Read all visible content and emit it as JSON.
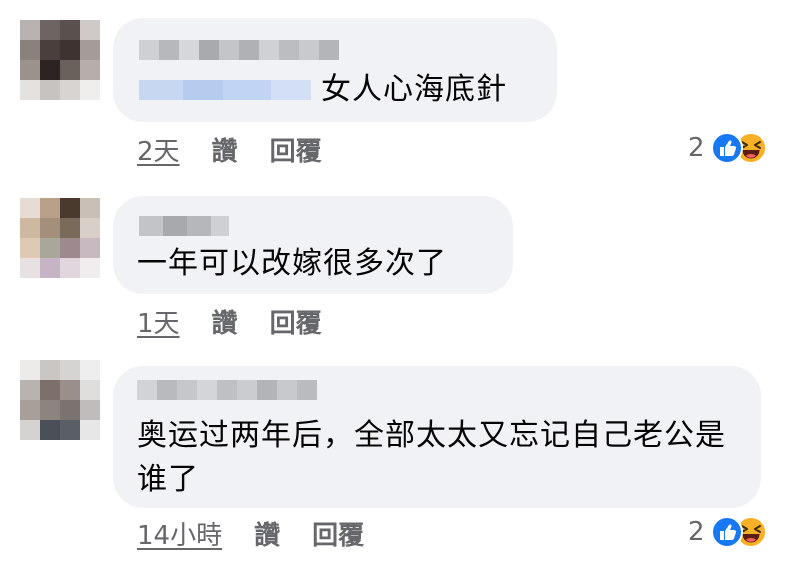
{
  "comments": [
    {
      "text": "女人心海底針",
      "time": "2天",
      "like_label": "讚",
      "reply_label": "回覆",
      "reaction_count": "2"
    },
    {
      "text": "一年可以改嫁很多次了",
      "time": "1天",
      "like_label": "讚",
      "reply_label": "回覆"
    },
    {
      "text": "奥运过两年后，全部太太又忘记自己老公是谁了",
      "time": "14小時",
      "like_label": "讚",
      "reply_label": "回覆",
      "reaction_count": "2"
    }
  ],
  "colors": {
    "bubble": "#f0f2f5",
    "secondary_text": "#65676b",
    "like_blue": "#1877f2",
    "haha_yellow": "#f7b125"
  },
  "icons": [
    "like-reaction-icon",
    "haha-reaction-icon"
  ]
}
